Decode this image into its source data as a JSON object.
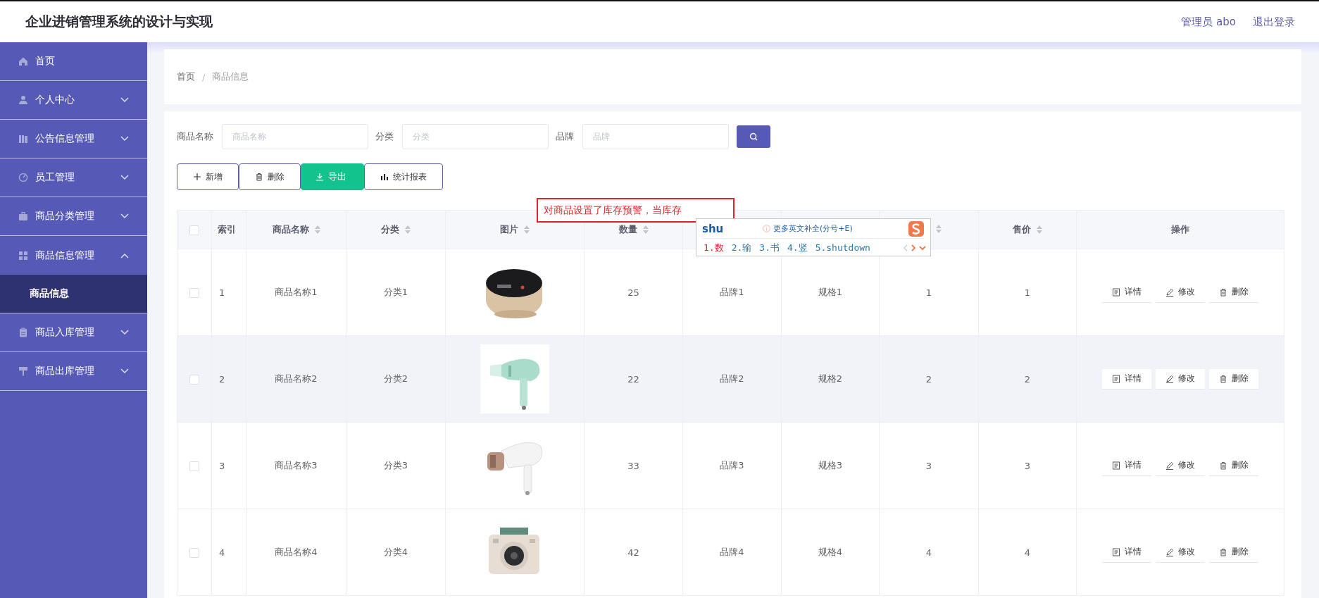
{
  "header": {
    "title": "企业进销管理系统的设计与实现",
    "user": "管理员 abo",
    "logout": "退出登录"
  },
  "sidebar": {
    "items": [
      {
        "label": "首页",
        "kind": "link"
      },
      {
        "label": "个人中心",
        "kind": "menu",
        "expanded": false
      },
      {
        "label": "公告信息管理",
        "kind": "menu",
        "expanded": false
      },
      {
        "label": "员工管理",
        "kind": "menu",
        "expanded": false
      },
      {
        "label": "商品分类管理",
        "kind": "menu",
        "expanded": false
      },
      {
        "label": "商品信息管理",
        "kind": "menu",
        "expanded": true,
        "children": [
          {
            "label": "商品信息",
            "selected": true
          }
        ]
      },
      {
        "label": "商品入库管理",
        "kind": "menu",
        "expanded": false
      },
      {
        "label": "商品出库管理",
        "kind": "menu",
        "expanded": false
      }
    ]
  },
  "breadcrumb": {
    "items": [
      "首页",
      "商品信息"
    ],
    "separator": "/"
  },
  "search": {
    "fields": [
      {
        "label": "商品名称",
        "placeholder": "商品名称"
      },
      {
        "label": "分类",
        "placeholder": "分类"
      },
      {
        "label": "品牌",
        "placeholder": "品牌"
      }
    ]
  },
  "toolbar": [
    {
      "label": "新增",
      "kind": "add"
    },
    {
      "label": "删除",
      "kind": "delete"
    },
    {
      "label": "导出",
      "kind": "export"
    },
    {
      "label": "统计报表",
      "kind": "report"
    }
  ],
  "table": {
    "select_all": {
      "checked": false
    },
    "columns": [
      {
        "kind": "checkbox"
      },
      {
        "label": "索引",
        "sortable": false
      },
      {
        "label": "商品名称",
        "sortable": true
      },
      {
        "label": "分类",
        "sortable": true
      },
      {
        "label": "图片",
        "sortable": true
      },
      {
        "label": "数量",
        "sortable": true
      },
      {
        "kind": "hidden"
      },
      {
        "kind": "hidden"
      },
      {
        "sortable": true
      },
      {
        "label": "售价",
        "sortable": true
      },
      {
        "label": "操作",
        "sortable": false
      }
    ],
    "rows": [
      {
        "selected": false,
        "highlighted": false,
        "index": "1",
        "name": "商品名称1",
        "category": "分类1",
        "quantity": "25",
        "brand": "品牌1",
        "spec": "规格1",
        "column_9": "1",
        "price": "1",
        "actions": [
          "详情",
          "修改",
          "删除"
        ]
      },
      {
        "selected": false,
        "highlighted": true,
        "index": "2",
        "name": "商品名称2",
        "category": "分类2",
        "quantity": "22",
        "brand": "品牌2",
        "spec": "规格2",
        "column_9": "2",
        "price": "2",
        "actions": [
          "详情",
          "修改",
          "删除"
        ]
      },
      {
        "selected": false,
        "highlighted": false,
        "index": "3",
        "name": "商品名称3",
        "category": "分类3",
        "quantity": "33",
        "brand": "品牌3",
        "spec": "规格3",
        "column_9": "3",
        "price": "3",
        "actions": [
          "详情",
          "修改",
          "删除"
        ]
      },
      {
        "selected": false,
        "highlighted": false,
        "index": "4",
        "name": "商品名称4",
        "category": "分类4",
        "quantity": "42",
        "brand": "品牌4",
        "spec": "规格4",
        "column_9": "4",
        "price": "4",
        "actions": [
          "详情",
          "修改",
          "删除"
        ]
      }
    ]
  },
  "text_input": {
    "value": "对商品设置了库存预警，当库存"
  },
  "ime": {
    "composition": "shu",
    "hint": "更多英文补全(分号+E)",
    "candidates": [
      {
        "text": "1.数",
        "selected": true
      },
      {
        "text": "2.输",
        "selected": false
      },
      {
        "text": "3.书",
        "selected": false
      },
      {
        "text": "4.竖",
        "selected": false
      },
      {
        "text": "5.shutdown",
        "selected": false
      }
    ]
  }
}
